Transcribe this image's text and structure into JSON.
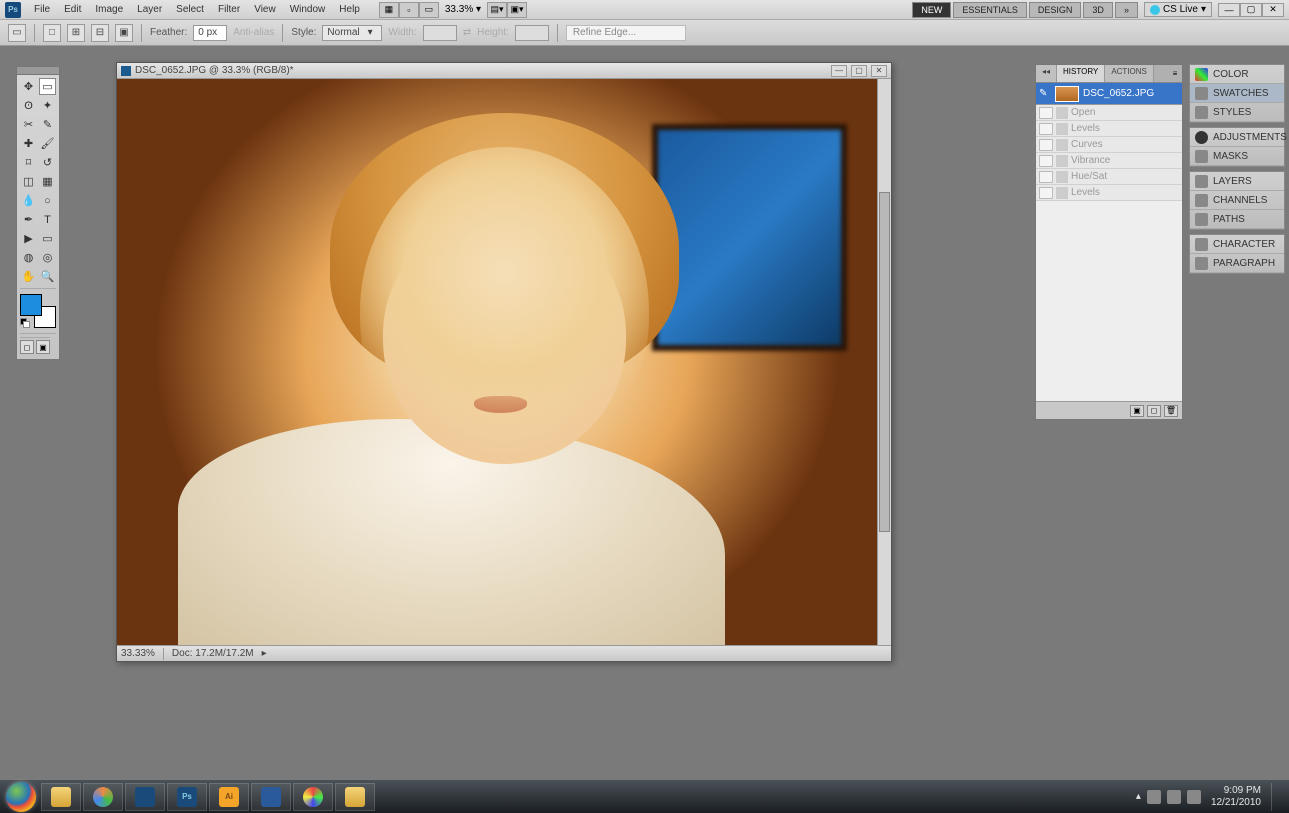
{
  "menubar": {
    "items": [
      "File",
      "Edit",
      "Image",
      "Layer",
      "Select",
      "Filter",
      "View",
      "Window",
      "Help"
    ],
    "zoom_value": "33.3",
    "zoom_suffix": "%"
  },
  "workspaces": {
    "tabs": [
      "ESSENTIALS",
      "DESIGN",
      "3D"
    ],
    "extra_left": "NEW",
    "cslive": "CS Live"
  },
  "optionsbar": {
    "feather_label": "Feather:",
    "feather_value": "0 px",
    "antialias": "Anti-alias",
    "style_label": "Style:",
    "style_value": "Normal",
    "width_label": "Width:",
    "height_label": "Height:",
    "refine": "Refine Edge..."
  },
  "tools": [
    "move",
    "marquee",
    "lasso",
    "wand",
    "crop",
    "eyedropper",
    "healing",
    "brush",
    "stamp",
    "history-brush",
    "eraser",
    "gradient",
    "blur",
    "dodge",
    "pen",
    "type",
    "path-select",
    "shape",
    "3d",
    "hand",
    "rotate",
    "zoom"
  ],
  "document": {
    "title": "DSC_0652.JPG @ 33.3% (RGB/8)*",
    "status_left": "33.33%",
    "status_doc": "Doc: 17.2M/17.2M"
  },
  "history": {
    "tabs": [
      "HISTORY",
      "ACTIONS"
    ],
    "snapshot": "DSC_0652.JPG",
    "states": [
      "Open",
      "Levels",
      "Curves",
      "Vibrance",
      "Hue/Sat",
      "Levels"
    ]
  },
  "rightdock": {
    "group1": [
      "COLOR",
      "SWATCHES",
      "STYLES"
    ],
    "group2": [
      "ADJUSTMENTS",
      "MASKS"
    ],
    "group3": [
      "LAYERS",
      "CHANNELS",
      "PATHS"
    ],
    "group4": [
      "CHARACTER",
      "PARAGRAPH"
    ]
  },
  "taskbar": {
    "apps": [
      "explorer",
      "chrome",
      "photoshop-file",
      "photoshop",
      "illustrator",
      "word",
      "picasa",
      "folder"
    ],
    "time": "9:09 PM",
    "date": "12/21/2010"
  }
}
